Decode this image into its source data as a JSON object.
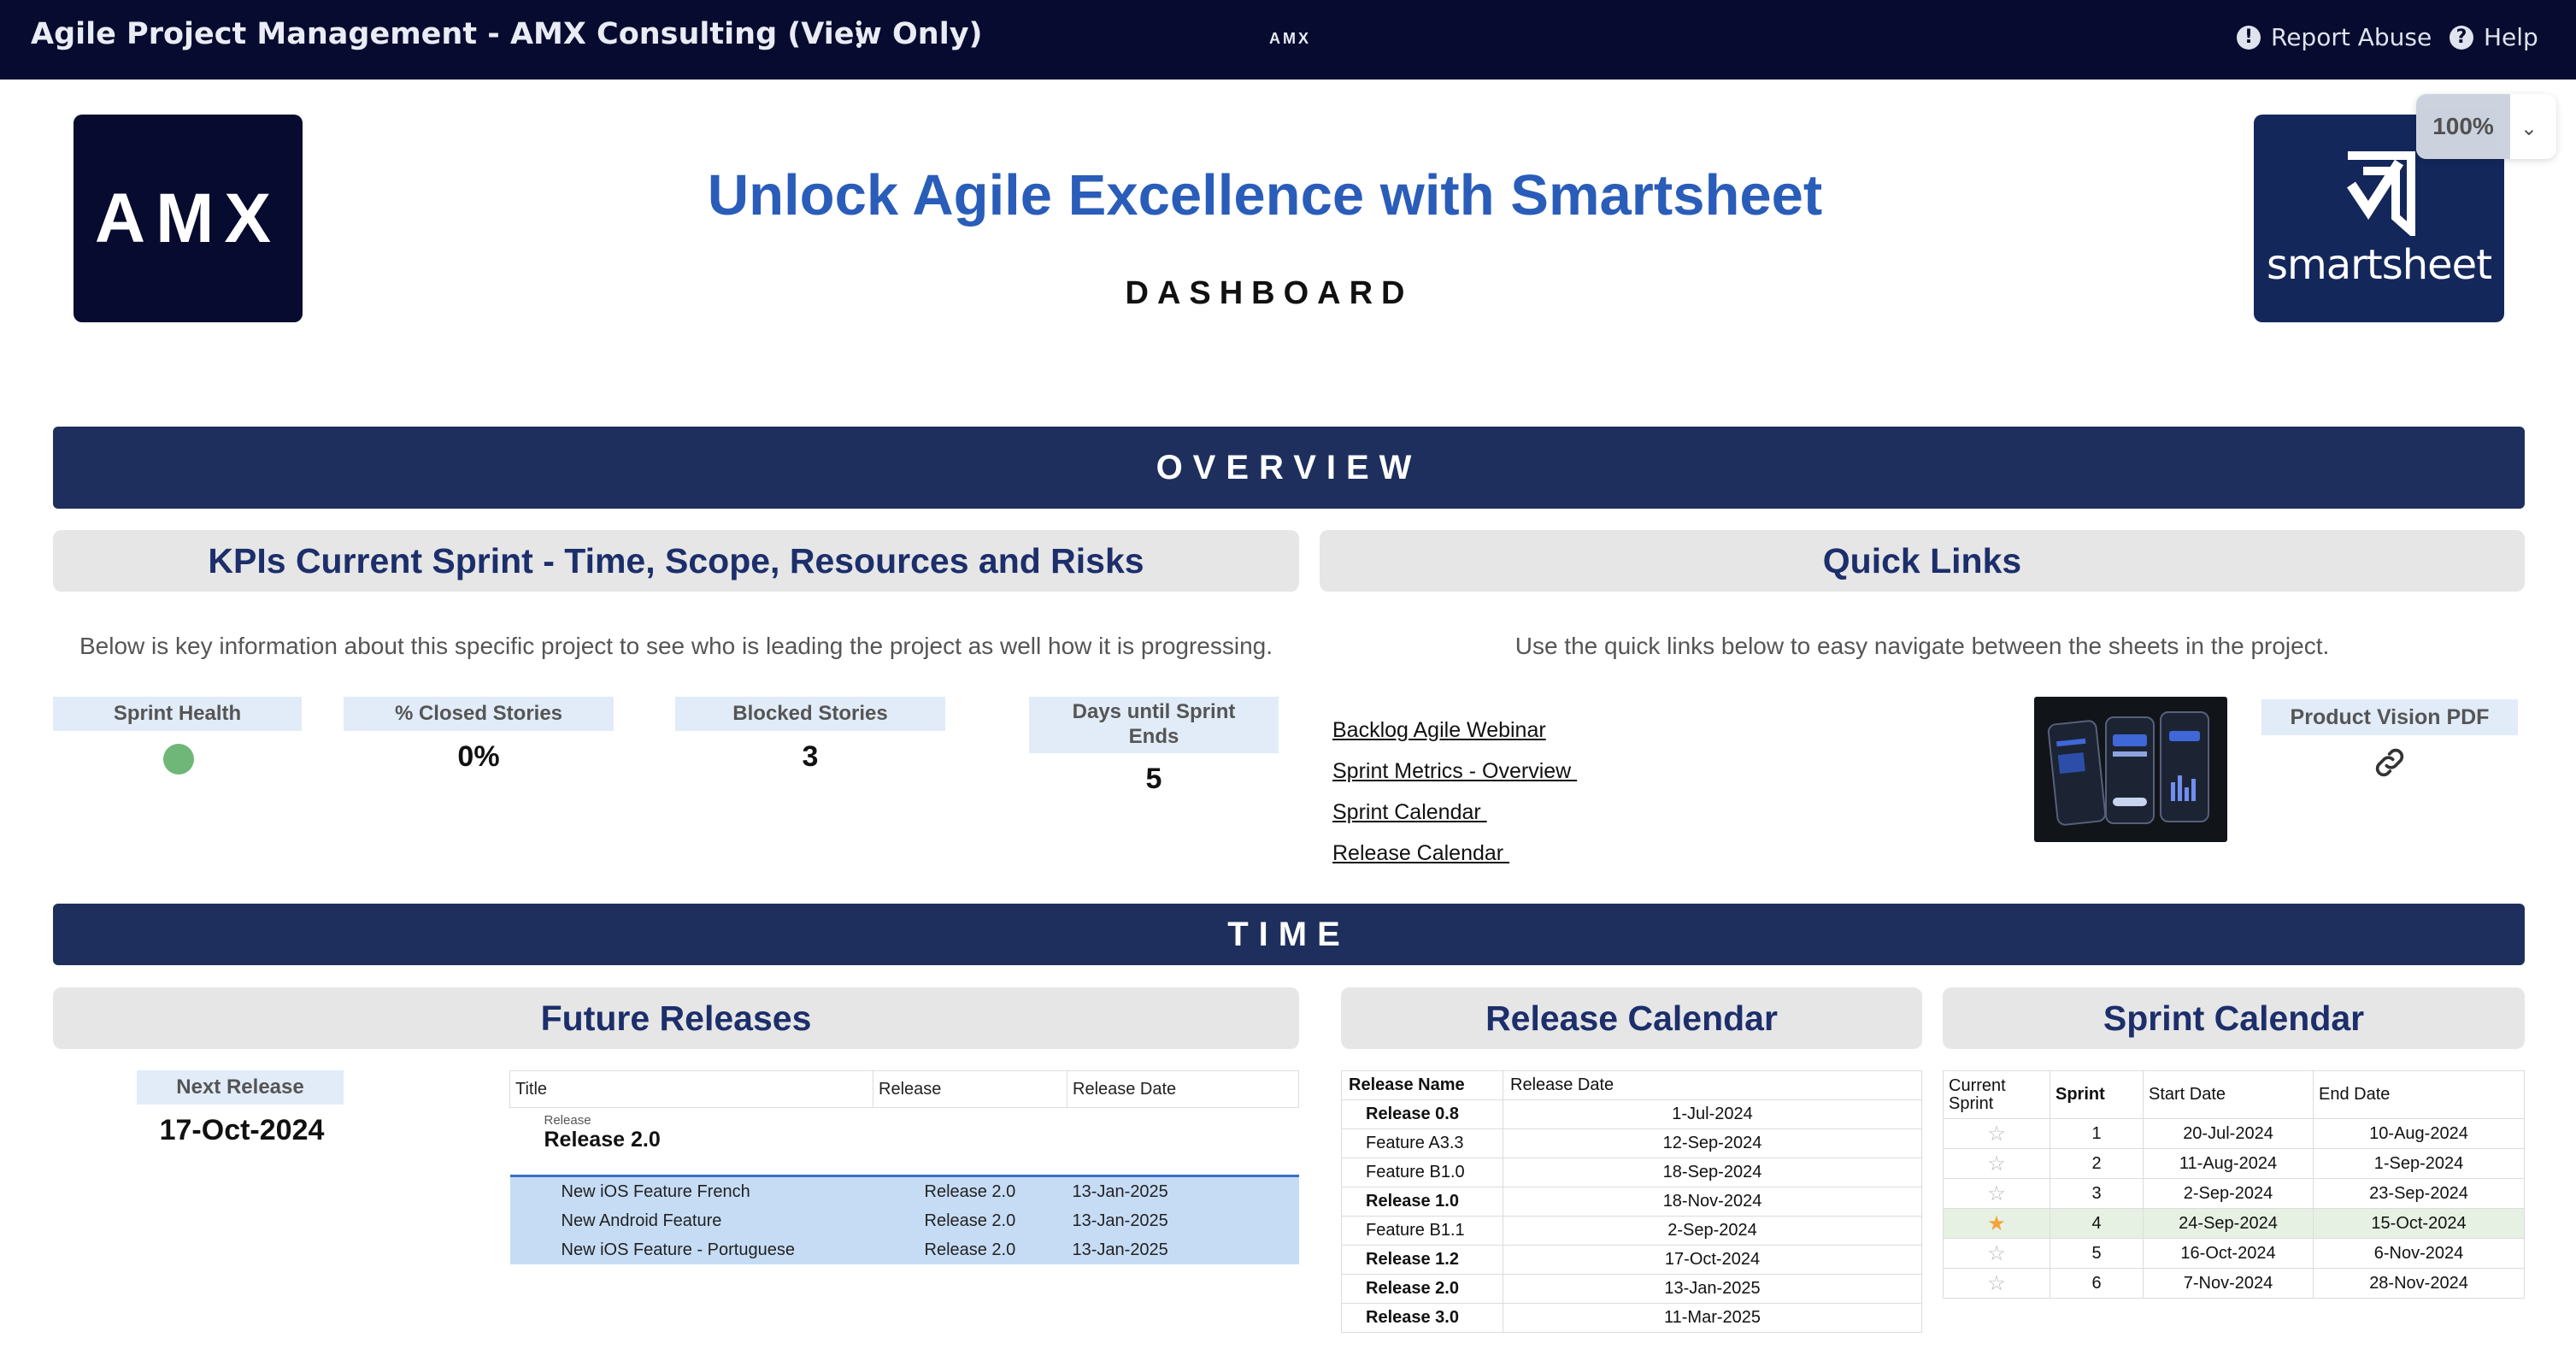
{
  "app": {
    "title": "Agile Project Management - AMX Consulting (View Only)",
    "center_label": "AMX",
    "report_abuse": "Report Abuse",
    "help": "Help"
  },
  "header": {
    "left_logo_text": "AMX",
    "right_logo_text": "smartsheet",
    "zoom": "100%",
    "title": "Unlock Agile Excellence with Smartsheet",
    "subtitle": "DASHBOARD"
  },
  "overview": {
    "bar_label": "OVERVIEW",
    "kpi_panel": {
      "heading": "KPIs Current Sprint - Time, Scope, Resources and Risks",
      "description": "Below is key information about this specific project to see who is leading the project as well how it is progressing.",
      "kpis": [
        {
          "label": "Sprint Health",
          "status_color": "#6fb779"
        },
        {
          "label": "% Closed Stories",
          "value": "0%"
        },
        {
          "label": "Blocked Stories",
          "value": "3"
        },
        {
          "label": "Days until Sprint Ends",
          "value": "5"
        }
      ]
    },
    "quick_links": {
      "heading": "Quick Links",
      "description": "Use the quick links below to easy navigate between the sheets in the project.",
      "links": [
        "Backlog Agile Webinar",
        "Sprint Metrics - Overview ",
        "Sprint Calendar ",
        "Release Calendar "
      ],
      "pdf_label": "Product Vision PDF"
    }
  },
  "time": {
    "bar_label": "TIME",
    "future_releases": {
      "heading": "Future Releases",
      "next_release_label": "Next Release",
      "next_release_date": "17-Oct-2024",
      "columns": [
        "Title",
        "Release",
        "Release Date"
      ],
      "group_label": "Release",
      "group_title": "Release 2.0",
      "rows": [
        {
          "title": "New iOS Feature French",
          "release": "Release 2.0",
          "date": "13-Jan-2025"
        },
        {
          "title": "New Android Feature",
          "release": "Release 2.0",
          "date": "13-Jan-2025"
        },
        {
          "title": "New iOS Feature - Portuguese",
          "release": "Release 2.0",
          "date": "13-Jan-2025"
        }
      ]
    },
    "release_calendar": {
      "heading": "Release Calendar",
      "columns": [
        "Release Name",
        "Release Date"
      ],
      "rows": [
        {
          "name": "Release 0.8",
          "date": "1-Jul-2024",
          "bold": true
        },
        {
          "name": "Feature A3.3",
          "date": "12-Sep-2024",
          "bold": false
        },
        {
          "name": "Feature B1.0",
          "date": "18-Sep-2024",
          "bold": false
        },
        {
          "name": "Release 1.0",
          "date": "18-Nov-2024",
          "bold": true
        },
        {
          "name": "Feature B1.1",
          "date": "2-Sep-2024",
          "bold": false
        },
        {
          "name": "Release 1.2",
          "date": "17-Oct-2024",
          "bold": true
        },
        {
          "name": "Release 2.0",
          "date": "13-Jan-2025",
          "bold": true
        },
        {
          "name": "Release 3.0",
          "date": "11-Mar-2025",
          "bold": true
        }
      ]
    },
    "sprint_calendar": {
      "heading": "Sprint Calendar",
      "columns": [
        "Current Sprint",
        "Sprint",
        "Start Date",
        "End Date"
      ],
      "rows": [
        {
          "current": false,
          "sprint": "1",
          "start": "20-Jul-2024",
          "end": "10-Aug-2024"
        },
        {
          "current": false,
          "sprint": "2",
          "start": "11-Aug-2024",
          "end": "1-Sep-2024"
        },
        {
          "current": false,
          "sprint": "3",
          "start": "2-Sep-2024",
          "end": "23-Sep-2024"
        },
        {
          "current": true,
          "sprint": "4",
          "start": "24-Sep-2024",
          "end": "15-Oct-2024"
        },
        {
          "current": false,
          "sprint": "5",
          "start": "16-Oct-2024",
          "end": "6-Nov-2024"
        },
        {
          "current": false,
          "sprint": "6",
          "start": "7-Nov-2024",
          "end": "28-Nov-2024"
        }
      ]
    }
  }
}
